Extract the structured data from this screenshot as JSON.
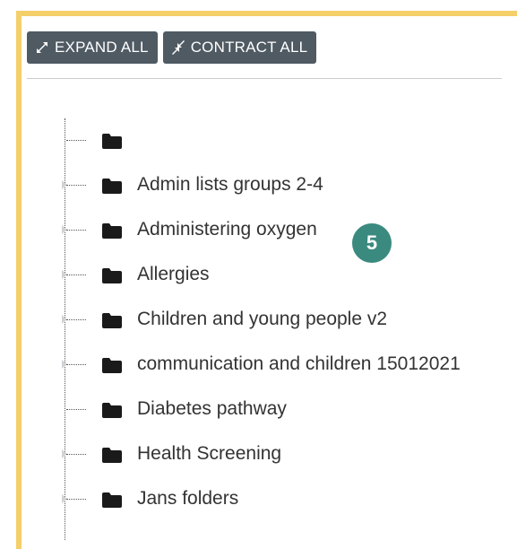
{
  "toolbar": {
    "expand_label": "EXPAND ALL",
    "contract_label": "CONTRACT ALL"
  },
  "tree": {
    "items": [
      {
        "label": "",
        "has_children": false
      },
      {
        "label": "Admin lists groups 2-4",
        "has_children": true
      },
      {
        "label": "Administering oxygen",
        "has_children": true
      },
      {
        "label": "Allergies",
        "has_children": true
      },
      {
        "label": "Children and young people v2",
        "has_children": true
      },
      {
        "label": "communication and children 15012021",
        "has_children": true
      },
      {
        "label": "Diabetes pathway",
        "has_children": false
      },
      {
        "label": "Health Screening",
        "has_children": true
      },
      {
        "label": "Jans folders",
        "has_children": true
      }
    ]
  },
  "step_badge": {
    "number": "5"
  },
  "colors": {
    "frame_accent": "#f5cf6a",
    "button_bg": "#4f5a63",
    "badge_bg": "#3a8a7f",
    "folder": "#1a1a1a"
  },
  "icons": {
    "expand": "expand-arrows-icon",
    "contract": "contract-arrows-icon",
    "folder": "folder-icon",
    "expander": "caret-right-icon"
  }
}
